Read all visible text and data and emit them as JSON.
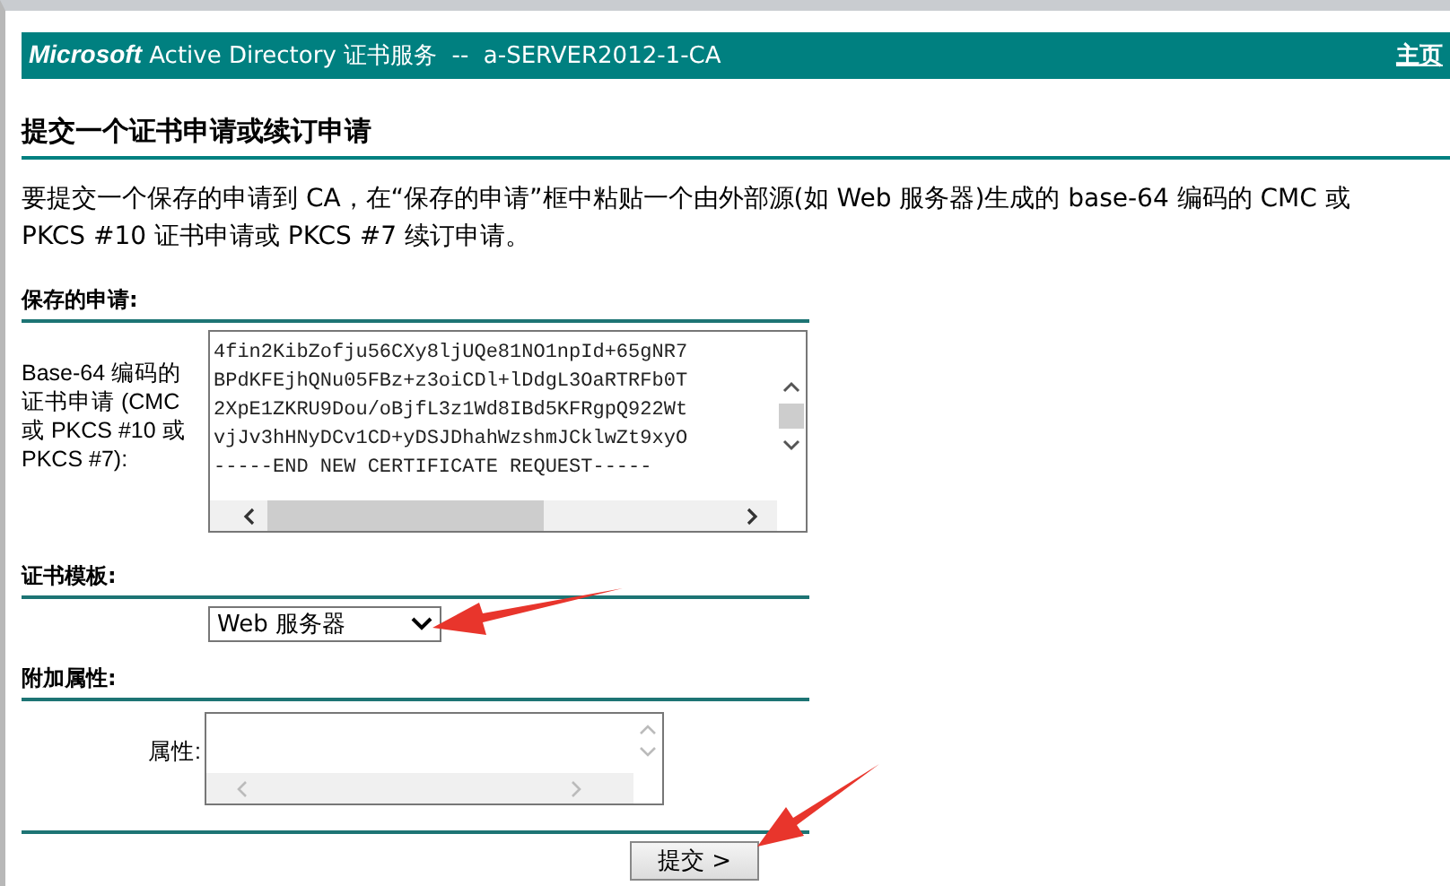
{
  "header": {
    "brand": "Microsoft",
    "title": "Active Directory 证书服务  --  a-SERVER2012-1-CA",
    "home_link": "主页"
  },
  "page_title": "提交一个证书申请或续订申请",
  "intro": "要提交一个保存的申请到 CA，在“保存的申请”框中粘贴一个由外部源(如 Web 服务器)生成的 base-64 编码的 CMC 或 PKCS #10 证书申请或 PKCS #7 续订申请。",
  "saved_request": {
    "heading": "保存的申请:",
    "label": "Base-64 编码的证书申请 (CMC 或 PKCS #10 或 PKCS #7):",
    "value_lines": [
      "4fin2KibZofju56CXy8ljUQe81NO1npId+65gNR7",
      "BPdKFEjhQNu05FBz+z3oiCDl+lDdgL3OaRTRFb0T",
      "2XpE1ZKRU9Dou/oBjfL3z1Wd8IBd5KFRgpQ922Wt",
      "vjJv3hHNyDCv1CD+yDSJDhahWzshmJCklwZt9xyO",
      "-----END NEW CERTIFICATE REQUEST-----"
    ]
  },
  "template": {
    "heading": "证书模板:",
    "value": "Web 服务器"
  },
  "attributes": {
    "heading": "附加属性:",
    "label": "属性:"
  },
  "submit_button": "提交 >"
}
